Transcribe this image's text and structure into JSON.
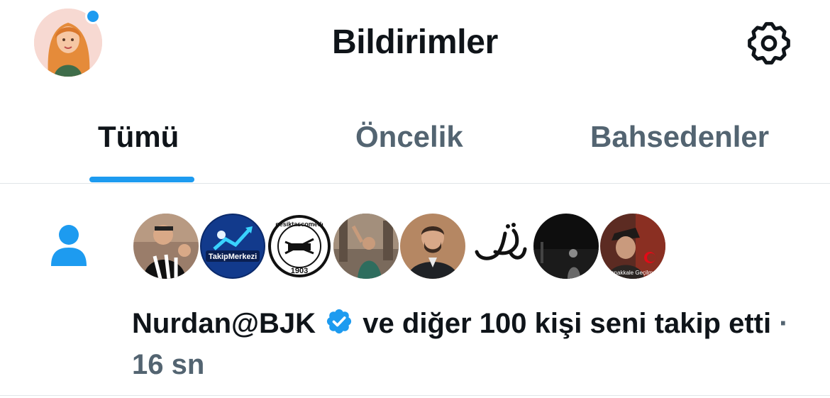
{
  "header": {
    "title": "Bildirimler"
  },
  "tabs": [
    {
      "label": "Tümü"
    },
    {
      "label": "Öncelik"
    },
    {
      "label": "Bahsedenler"
    }
  ],
  "notification": {
    "user": "Nurdan@BJK",
    "action": "ve diğer 100 kişi seni takip etti",
    "separator": "·",
    "time": "16 sn",
    "avatar_texts": {
      "takip": "TakipMerkezi",
      "besiktas_name": "besiktascomedi",
      "besiktas_year": "1903",
      "canakkale": "Çanakkale Geçilmez"
    }
  },
  "colors": {
    "accent": "#1d9bf0",
    "text": "#0f1419",
    "secondary": "#536471",
    "divider": "#e1e5e8"
  },
  "icons": [
    "gear-icon",
    "person-icon",
    "verified-badge-icon"
  ]
}
